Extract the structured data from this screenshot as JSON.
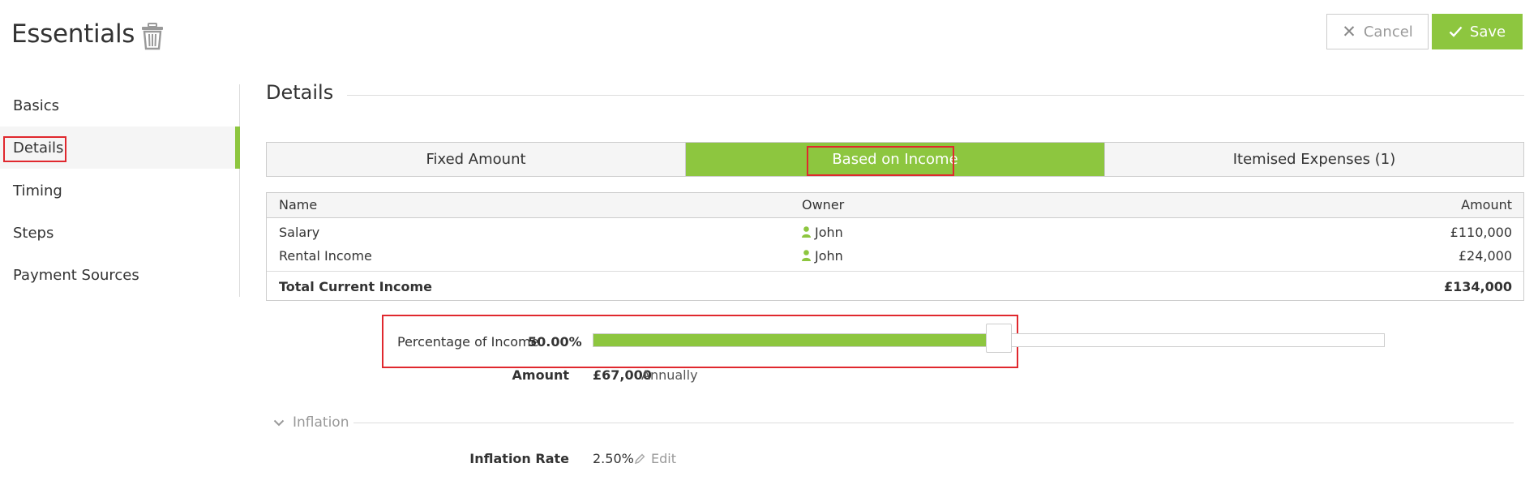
{
  "header": {
    "title": "Essentials",
    "trash_icon": "trash-icon",
    "cancel_label": "Cancel",
    "cancel_icon": "close-icon",
    "save_label": "Save",
    "save_icon": "check-icon"
  },
  "sidebar": {
    "items": [
      {
        "label": "Basics",
        "active": false
      },
      {
        "label": "Details",
        "active": true
      },
      {
        "label": "Timing",
        "active": false
      },
      {
        "label": "Steps",
        "active": false
      },
      {
        "label": "Payment Sources",
        "active": false
      }
    ]
  },
  "section": {
    "title": "Details"
  },
  "tabs": [
    {
      "label": "Fixed Amount",
      "active": false
    },
    {
      "label": "Based on Income",
      "active": true
    },
    {
      "label": "Itemised Expenses (1)",
      "active": false
    }
  ],
  "income_table": {
    "columns": {
      "name": "Name",
      "owner": "Owner",
      "amount": "Amount"
    },
    "rows": [
      {
        "name": "Salary",
        "owner": "John",
        "amount": "£110,000"
      },
      {
        "name": "Rental Income",
        "owner": "John",
        "amount": "£24,000"
      }
    ],
    "total": {
      "label": "Total Current Income",
      "amount": "£134,000"
    }
  },
  "percentage": {
    "label": "Percentage of Income",
    "value_text": "50.00%",
    "value": 0.5
  },
  "amount": {
    "label": "Amount",
    "value": "£67,000",
    "period": "Annually"
  },
  "inflation": {
    "header": "Inflation",
    "rate_label": "Inflation Rate",
    "rate_value": "2.50%",
    "edit_label": "Edit"
  },
  "colors": {
    "accent": "#8dc63f",
    "highlight": "#e0282e",
    "border": "#cccccc"
  }
}
